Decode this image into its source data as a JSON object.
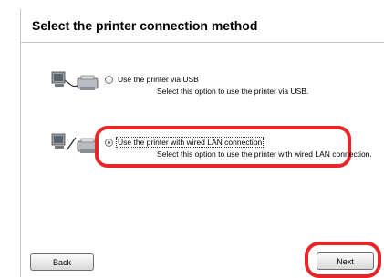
{
  "dialog": {
    "title": "Select the printer connection method"
  },
  "options": [
    {
      "label": "Use the printer via USB",
      "description": "Select this option to use the printer via USB.",
      "selected": false,
      "icon": "usb-printer-icon"
    },
    {
      "label": "Use the printer with wired LAN connection",
      "description": "Select this option to use the printer with wired LAN connection.",
      "selected": true,
      "icon": "lan-printer-icon"
    }
  ],
  "buttons": {
    "back_label": "Back",
    "next_label": "Next"
  },
  "colors": {
    "highlight": "#e8262a"
  }
}
